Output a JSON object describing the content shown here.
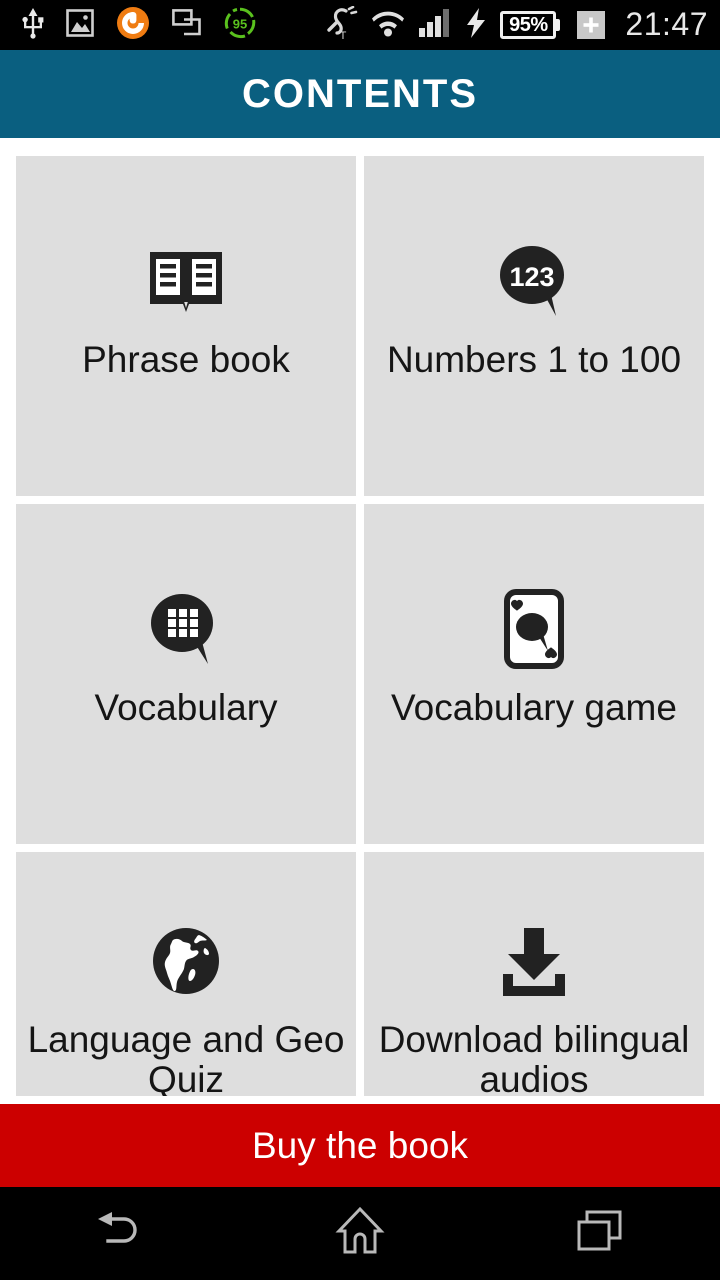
{
  "status_bar": {
    "icons_left": [
      {
        "name": "usb-icon",
        "label": "USB"
      },
      {
        "name": "screenshot-image-icon",
        "label": "Screenshot"
      },
      {
        "name": "sync-orange-icon",
        "label": "Sync"
      },
      {
        "name": "screen-mirror-icon",
        "label": "Screen mirroring"
      },
      {
        "name": "stamina-95-icon",
        "label": "95"
      }
    ],
    "icons_right": [
      {
        "name": "hearing-aid-icon",
        "label": "Hearing aid T"
      },
      {
        "name": "wifi-icon",
        "label": "Wi-Fi"
      },
      {
        "name": "cellular-signal-icon",
        "label": "Signal"
      },
      {
        "name": "charging-bolt-icon",
        "label": "Charging"
      }
    ],
    "battery_percent": "95%",
    "plus_badge": "+",
    "clock": "21:47"
  },
  "app_bar": {
    "title": "CONTENTS"
  },
  "grid": {
    "rows": [
      [
        {
          "icon": "open-book-icon",
          "label": "Phrase book"
        },
        {
          "icon": "numbers-speech-bubble-icon",
          "label": "Numbers 1 to 100",
          "bubble_text": "123"
        }
      ],
      [
        {
          "icon": "grid-speech-bubble-icon",
          "label": "Vocabulary"
        },
        {
          "icon": "playing-card-icon",
          "label": "Vocabulary game"
        }
      ],
      [
        {
          "icon": "globe-icon",
          "label": "Language and Geo Quiz"
        },
        {
          "icon": "download-icon",
          "label": "Download bilingual audios"
        }
      ]
    ]
  },
  "buy_bar": {
    "label": "Buy the book"
  },
  "nav_bar": {
    "buttons": [
      {
        "name": "back-button",
        "label": "Back"
      },
      {
        "name": "home-button",
        "label": "Home"
      },
      {
        "name": "recents-button",
        "label": "Recent apps"
      }
    ]
  },
  "colors": {
    "app_bar": "#0a5f80",
    "tile": "#dedede",
    "buy_bar": "#cc0000",
    "status_bar": "#000000",
    "icon_dark": "#222222",
    "sync_orange": "#ef7c12",
    "stamina_green": "#5ac11e"
  }
}
